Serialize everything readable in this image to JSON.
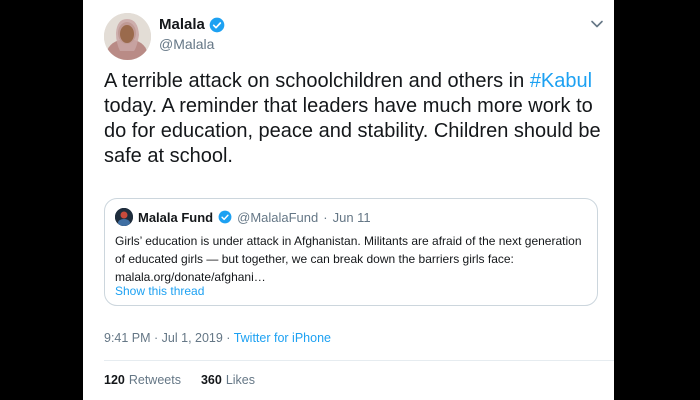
{
  "tweet": {
    "author_name": "Malala",
    "author_handle": "@Malala",
    "text_before": "A terrible attack on schoolchildren and others in ",
    "hashtag": "#Kabul",
    "text_after": " today. A reminder that leaders have much more work to do for education, peace and stability. Children should be safe at school."
  },
  "quoted": {
    "name": "Malala Fund",
    "handle": "@MalalaFund",
    "separator": "·",
    "date": "Jun 11",
    "text": "Girls’ education is under attack in Afghanistan. Militants are afraid of the next generation of educated girls — but together, we can break down the barriers girls face: malala.org/donate/afghani…",
    "show_thread": "Show this thread"
  },
  "meta": {
    "timestamp": "9:41 PM · Jul 1, 2019 · ",
    "source": "Twitter for iPhone"
  },
  "stats": {
    "retweets_count": "120",
    "retweets_label": "Retweets",
    "likes_count": "360",
    "likes_label": "Likes"
  },
  "colors": {
    "link": "#1da1f2",
    "verified": "#1da1f2",
    "secondary_text": "#657786",
    "border": "#ccd6dd"
  },
  "icons": [
    "verified-badge-icon",
    "chevron-down-icon"
  ]
}
